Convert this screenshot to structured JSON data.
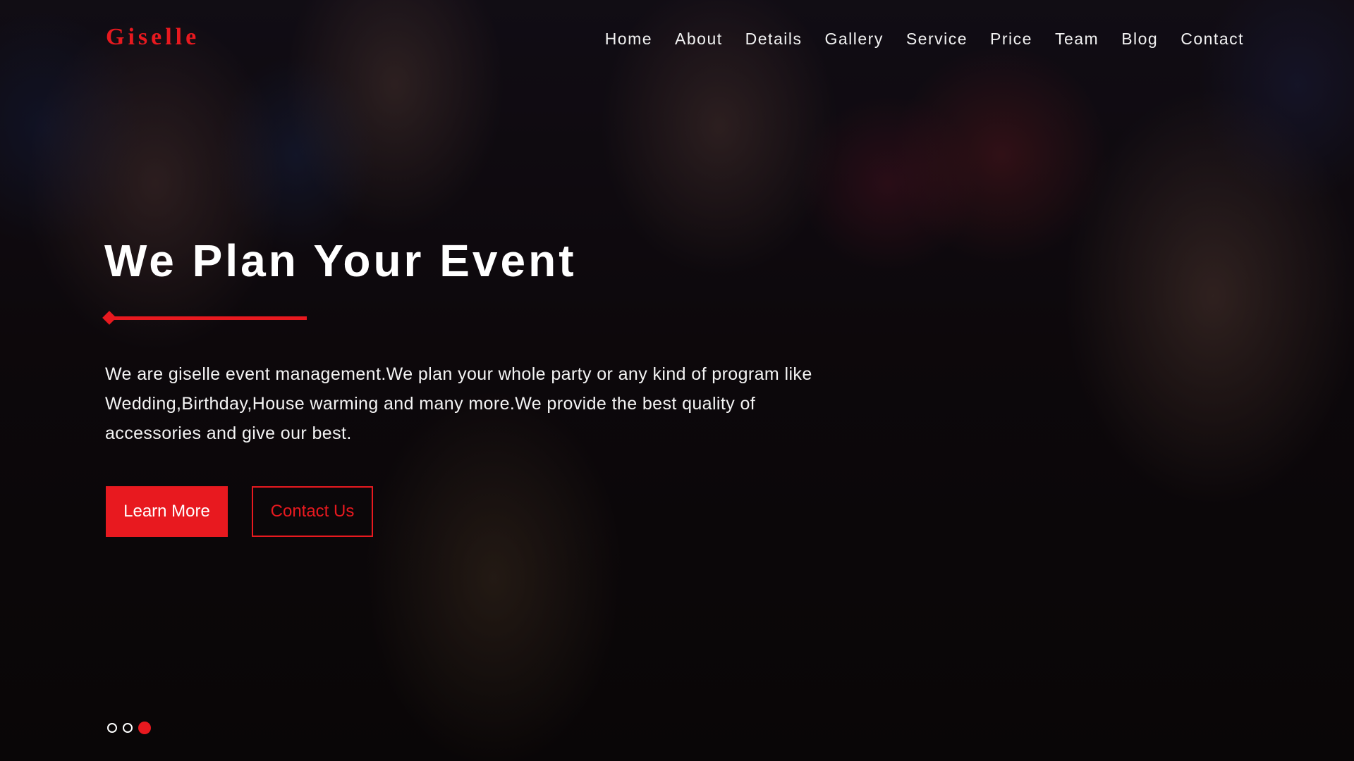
{
  "brand": {
    "logo_text": "Giselle",
    "accent_color": "#e8191f"
  },
  "nav": {
    "items": [
      {
        "label": "Home"
      },
      {
        "label": "About"
      },
      {
        "label": "Details"
      },
      {
        "label": "Gallery"
      },
      {
        "label": "Service"
      },
      {
        "label": "Price"
      },
      {
        "label": "Team"
      },
      {
        "label": "Blog"
      },
      {
        "label": "Contact"
      }
    ]
  },
  "hero": {
    "headline": "We Plan Your Event",
    "intro": "We are giselle event management.We plan your whole party or any kind of program like Wedding,Birthday,House warming and many more.We provide the best quality of accessories and give our best.",
    "primary_button": "Learn More",
    "secondary_button": "Contact Us"
  },
  "slider": {
    "slide_count": 3,
    "active_index": 2
  }
}
